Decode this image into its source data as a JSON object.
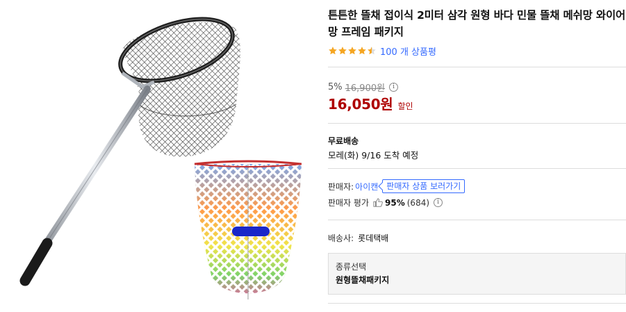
{
  "product": {
    "title": "튼튼한 뜰채 접이식 2미터 삼각 원형 바다 민물 뜰채 메쉬망 와이어망 프레임 패키지",
    "rating": 4.5,
    "review_count_text": "100 개 상품평"
  },
  "price": {
    "discount_rate": "5%",
    "original": "16,900원",
    "final": "16,050원",
    "discount_label": "할인"
  },
  "shipping": {
    "title": "무료배송",
    "arrival": "모레(화) 9/16 도착 예정"
  },
  "seller": {
    "label": "판매자:",
    "name": "아이캔",
    "products_button": "판매자 상품 보러가기",
    "rating_label": "판매자 평가",
    "rating_pct": "95%",
    "rating_count": "(684)"
  },
  "carrier": {
    "label": "배송사:",
    "value": "롯데택배"
  },
  "option": {
    "label": "종류선택",
    "value": "원형뜰채패키지"
  },
  "colors": {
    "price_red": "#ae0000",
    "link_blue": "#346aff",
    "star_orange": "#f5a623"
  }
}
